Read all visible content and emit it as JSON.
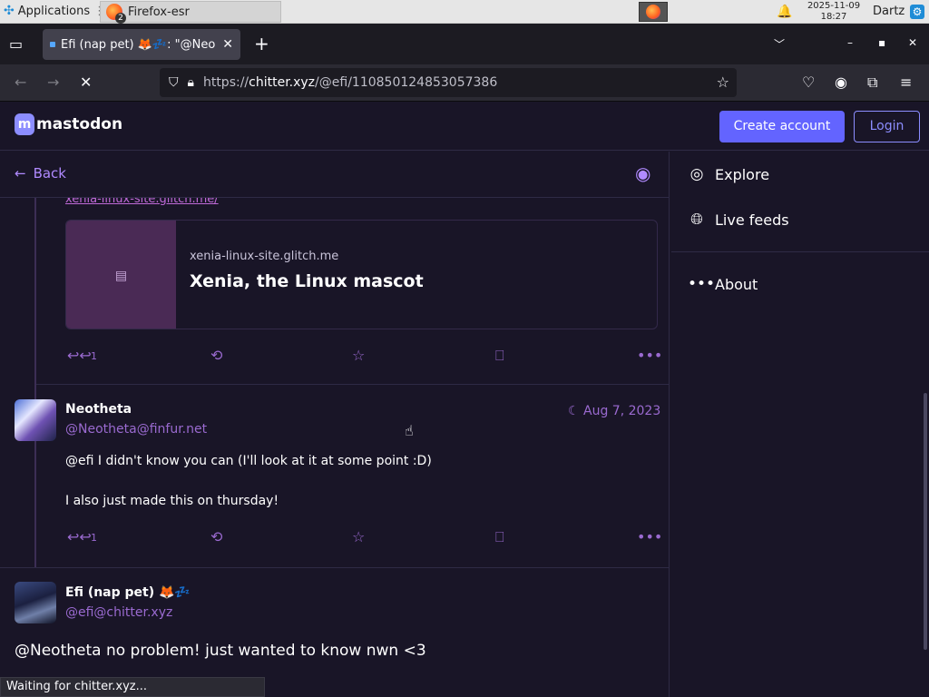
{
  "taskbar": {
    "applications_label": "Applications",
    "window_title": "Firefox-esr",
    "window_count": "2",
    "clock_date": "2025-11-09",
    "clock_time": "18:27",
    "user": "Dartz"
  },
  "browser": {
    "tab_title": "Efi (nap pet) 🦊💤: \"@Neo",
    "url_prefix": "https://",
    "url_domain": "chitter.xyz",
    "url_path": "/@efi/110850124853057386",
    "status": "Waiting for chitter.xyz..."
  },
  "header": {
    "logo_text": "mastodon",
    "create_account": "Create account",
    "login": "Login"
  },
  "column": {
    "back_label": "Back"
  },
  "post1": {
    "cut_link": "xenia-linux-site.glitch.me/",
    "card_domain": "xenia-linux-site.glitch.me",
    "card_title": "Xenia, the Linux mascot",
    "reply_count": "1"
  },
  "post2": {
    "display_name": "Neotheta",
    "handle": "@Neotheta@finfur.net",
    "date": "Aug 7, 2023",
    "text_line1": "@efi I didn't know you can (I'll look at it at some point :D)",
    "text_line2": "I also just made this on thursday!",
    "reply_count": "1"
  },
  "post3": {
    "display_name": "Efi (nap pet) 🦊💤",
    "handle": "@efi@chitter.xyz",
    "text": "@Neotheta no problem! just wanted to know nwn <3"
  },
  "sidebar": {
    "items": [
      {
        "label": "Explore",
        "icon": "compass-icon"
      },
      {
        "label": "Live feeds",
        "icon": "globe-icon"
      },
      {
        "label": "About",
        "icon": "ellipsis-icon"
      }
    ]
  }
}
